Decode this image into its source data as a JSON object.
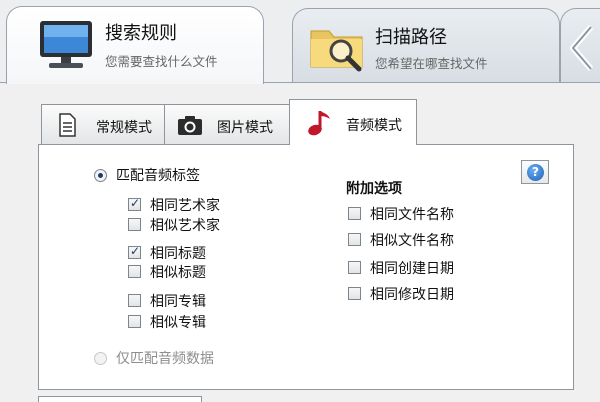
{
  "top_tabs": [
    {
      "title": "搜索规则",
      "subtitle": "您需要查找什么文件",
      "icon": "monitor-icon",
      "active": true
    },
    {
      "title": "扫描路径",
      "subtitle": "您希望在哪查找文件",
      "icon": "folder-search-icon",
      "active": false
    },
    {
      "icon": "back-arrow-icon"
    }
  ],
  "mode_tabs": [
    {
      "label": "常规模式",
      "icon": "document-icon",
      "active": false
    },
    {
      "label": "图片模式",
      "icon": "camera-icon",
      "active": false
    },
    {
      "label": "音频模式",
      "icon": "music-note-icon",
      "active": true
    }
  ],
  "audio_panel": {
    "match_tags": {
      "label": "匹配音频标签",
      "selected": true
    },
    "match_data": {
      "label": "仅匹配音频数据",
      "selected": false
    },
    "tag_options": [
      {
        "label": "相同艺术家",
        "checked": true
      },
      {
        "label": "相似艺术家",
        "checked": false
      },
      {
        "label": "相同标题",
        "checked": true
      },
      {
        "label": "相似标题",
        "checked": false
      },
      {
        "label": "相同专辑",
        "checked": false
      },
      {
        "label": "相似专辑",
        "checked": false
      }
    ],
    "extra_heading": "附加选项",
    "extra_options": [
      {
        "label": "相同文件名称",
        "checked": false
      },
      {
        "label": "相似文件名称",
        "checked": false
      },
      {
        "label": "相同创建日期",
        "checked": false
      },
      {
        "label": "相同修改日期",
        "checked": false
      }
    ],
    "help_icon": "question-icon"
  },
  "colors": {
    "accent": "#1c5fb3",
    "music_note": "#c0182a",
    "border": "#8f959c"
  }
}
